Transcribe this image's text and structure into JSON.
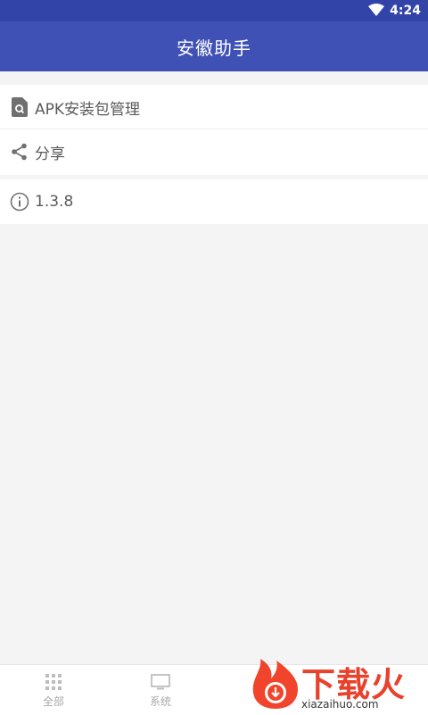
{
  "status_bar": {
    "time": "4:24",
    "icons": [
      "wifi-icon"
    ]
  },
  "app_bar": {
    "title": "安徽助手"
  },
  "menu": {
    "items": [
      {
        "label": "APK安装包管理",
        "icon": "apk-file-search-icon"
      },
      {
        "label": "分享",
        "icon": "share-icon"
      }
    ]
  },
  "version": {
    "label": "1.3.8",
    "icon": "info-icon"
  },
  "bottom_nav": {
    "items": [
      {
        "label": "全部",
        "icon": "grid-icon"
      },
      {
        "label": "系统",
        "icon": "monitor-icon"
      }
    ]
  },
  "watermark": {
    "text": "下载火",
    "sub": "xiazaihuo.com"
  },
  "colors": {
    "primary": "#3f51b5",
    "status_bar": "#3244a8",
    "background": "#f4f4f4",
    "watermark": "#e8412c"
  }
}
